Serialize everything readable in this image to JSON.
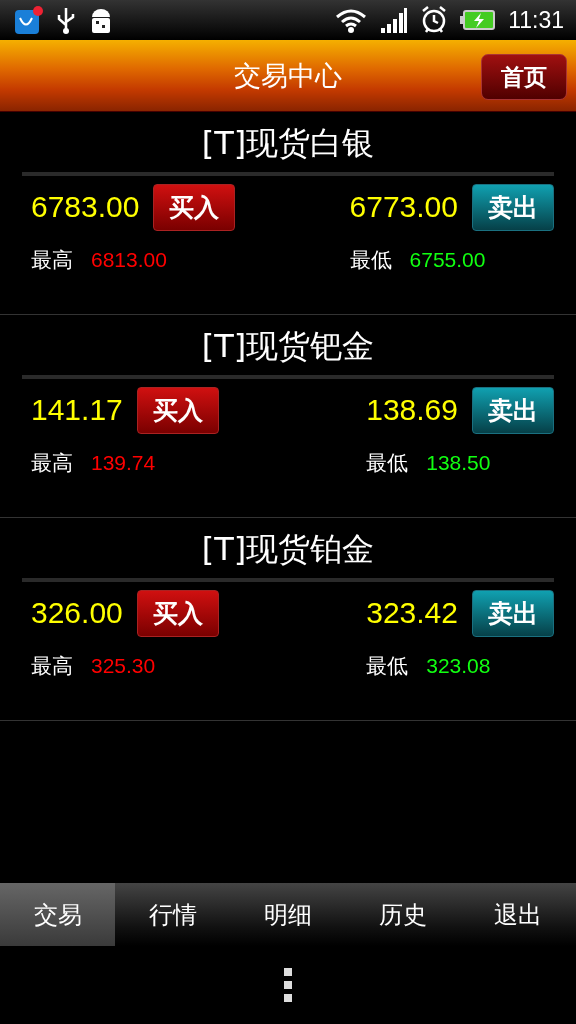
{
  "status_bar": {
    "time": "11:31"
  },
  "header": {
    "title": "交易中心",
    "home_button": "首页"
  },
  "products": [
    {
      "name": "[T]现货白银",
      "buy_price": "6783.00",
      "buy_button": "买入",
      "sell_price": "6773.00",
      "sell_button": "卖出",
      "high_label": "最高",
      "high": "6813.00",
      "low_label": "最低",
      "low": "6755.00"
    },
    {
      "name": "[T]现货钯金",
      "buy_price": "141.17",
      "buy_button": "买入",
      "sell_price": "138.69",
      "sell_button": "卖出",
      "high_label": "最高",
      "high": "139.74",
      "low_label": "最低",
      "low": "138.50"
    },
    {
      "name": "[T]现货铂金",
      "buy_price": "326.00",
      "buy_button": "买入",
      "sell_price": "323.42",
      "sell_button": "卖出",
      "high_label": "最高",
      "high": "325.30",
      "low_label": "最低",
      "low": "323.08"
    }
  ],
  "tabs": [
    {
      "label": "交易",
      "selected": true
    },
    {
      "label": "行情",
      "selected": false
    },
    {
      "label": "明细",
      "selected": false
    },
    {
      "label": "历史",
      "selected": false
    },
    {
      "label": "退出",
      "selected": false
    }
  ]
}
